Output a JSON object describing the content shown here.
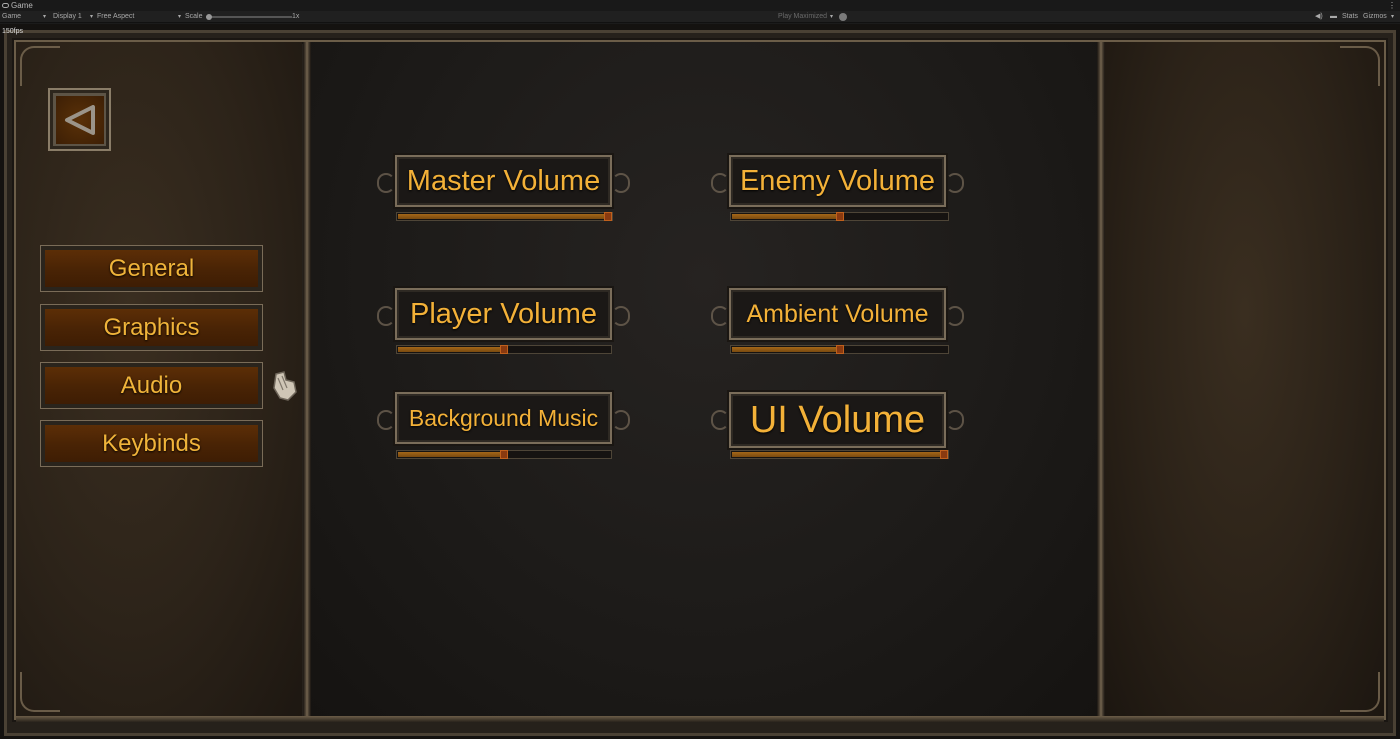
{
  "editor": {
    "tab_title": "Game",
    "game_dropdown": "Game",
    "display_dropdown": "Display 1",
    "aspect_dropdown": "Free Aspect",
    "scale_label": "Scale",
    "scale_value": "1x",
    "play_maximized": "Play Maximized",
    "stats": "Stats",
    "gizmos": "Gizmos"
  },
  "fps": "150fps",
  "sidebar": {
    "items": [
      {
        "label": "General"
      },
      {
        "label": "Graphics"
      },
      {
        "label": "Audio"
      },
      {
        "label": "Keybinds"
      }
    ]
  },
  "audio": {
    "sliders": [
      {
        "label": "Master Volume",
        "value": 1.0
      },
      {
        "label": "Enemy Volume",
        "value": 0.5
      },
      {
        "label": "Player Volume",
        "value": 0.5
      },
      {
        "label": "Ambient Volume",
        "value": 0.5
      },
      {
        "label": "Background Music",
        "value": 0.5
      },
      {
        "label": "UI Volume",
        "value": 1.0
      }
    ]
  },
  "colors": {
    "accent_text": "#f3b138",
    "button_face": "#5c2e06",
    "slider_fill": "#a46718"
  }
}
